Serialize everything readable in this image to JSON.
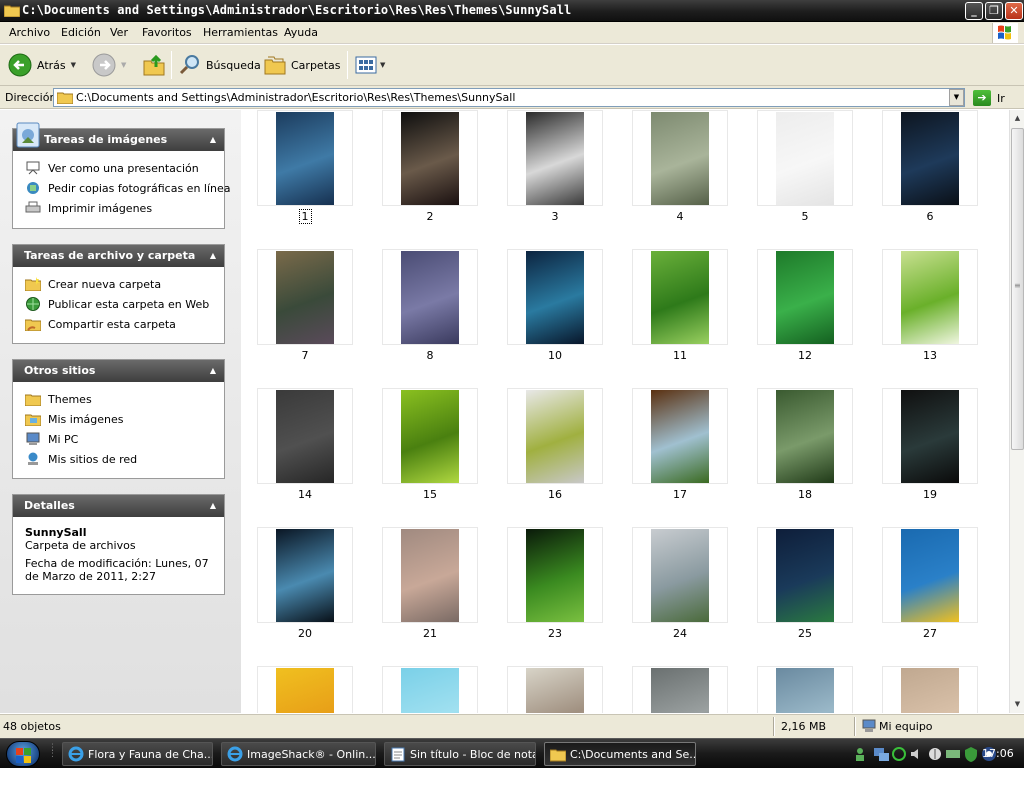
{
  "window": {
    "title": "C:\\Documents and Settings\\Administrador\\Escritorio\\Res\\Res\\Themes\\SunnySall"
  },
  "menu": [
    "Archivo",
    "Edición",
    "Ver",
    "Favoritos",
    "Herramientas",
    "Ayuda"
  ],
  "toolbar": {
    "back": "Atrás",
    "search": "Búsqueda",
    "folders": "Carpetas"
  },
  "address": {
    "label": "Dirección",
    "value": "C:\\Documents and Settings\\Administrador\\Escritorio\\Res\\Res\\Themes\\SunnySall",
    "go": "Ir"
  },
  "panels": {
    "images": {
      "title": "Tareas de imágenes",
      "items": [
        "Ver como una presentación",
        "Pedir copias fotográficas en línea",
        "Imprimir imágenes"
      ]
    },
    "files": {
      "title": "Tareas de archivo y carpeta",
      "items": [
        "Crear nueva carpeta",
        "Publicar esta carpeta en Web",
        "Compartir esta carpeta"
      ]
    },
    "places": {
      "title": "Otros sitios",
      "items": [
        "Themes",
        "Mis imágenes",
        "Mi PC",
        "Mis sitios de red"
      ]
    },
    "details": {
      "title": "Detalles",
      "name": "SunnySall",
      "type": "Carpeta de archivos",
      "modified": "Fecha de modificación: Lunes, 07 de Marzo de 2011, 2:27"
    }
  },
  "files": [
    {
      "label": "1",
      "colors": [
        "#1c3c5e",
        "#3f7aa6",
        "#163050"
      ]
    },
    {
      "label": "2",
      "colors": [
        "#0e0e0e",
        "#6a5a4a",
        "#1a1010"
      ]
    },
    {
      "label": "3",
      "colors": [
        "#2a2a2a",
        "#d8d8d8",
        "#3a3a3a"
      ]
    },
    {
      "label": "4",
      "colors": [
        "#7d8a70",
        "#a9b49a",
        "#556048"
      ]
    },
    {
      "label": "5",
      "colors": [
        "#ededed",
        "#f7f7f7",
        "#e4e4e4"
      ]
    },
    {
      "label": "6",
      "colors": [
        "#0d1520",
        "#1e3a5a",
        "#0a0f16"
      ]
    },
    {
      "label": "7",
      "colors": [
        "#7a6a4a",
        "#3a4a3a",
        "#5a4a5a"
      ]
    },
    {
      "label": "8",
      "colors": [
        "#4a4c74",
        "#7a7aa6",
        "#3a3a5e"
      ]
    },
    {
      "label": "10",
      "colors": [
        "#0c2440",
        "#2a7aa0",
        "#08162a"
      ]
    },
    {
      "label": "11",
      "colors": [
        "#6ab03a",
        "#2e7a1a",
        "#9ad060"
      ]
    },
    {
      "label": "12",
      "colors": [
        "#1e7a2a",
        "#3ab04a",
        "#146020"
      ]
    },
    {
      "label": "13",
      "colors": [
        "#c8e090",
        "#6ab02a",
        "#f0f6e0"
      ]
    },
    {
      "label": "14",
      "colors": [
        "#3a3a3a",
        "#505050",
        "#262626"
      ]
    },
    {
      "label": "15",
      "colors": [
        "#8ac020",
        "#4a8010",
        "#b0d840"
      ]
    },
    {
      "label": "16",
      "colors": [
        "#e8e8e8",
        "#a0b040",
        "#c8c8c8"
      ]
    },
    {
      "label": "17",
      "colors": [
        "#5a3010",
        "#a0c0d0",
        "#3a6a20"
      ]
    },
    {
      "label": "18",
      "colors": [
        "#3a5a30",
        "#7a9a6a",
        "#203a18"
      ]
    },
    {
      "label": "19",
      "colors": [
        "#101010",
        "#2a3a3a",
        "#0a0a0a"
      ]
    },
    {
      "label": "20",
      "colors": [
        "#0a1624",
        "#4a8ab0",
        "#081018"
      ]
    },
    {
      "label": "21",
      "colors": [
        "#a08a80",
        "#c8a898",
        "#7a6a64"
      ]
    },
    {
      "label": "23",
      "colors": [
        "#0a1a0a",
        "#3a8a20",
        "#7ac040"
      ]
    },
    {
      "label": "24",
      "colors": [
        "#c8ccd0",
        "#8a9aa0",
        "#4a6a3a"
      ]
    },
    {
      "label": "25",
      "colors": [
        "#0e1e3a",
        "#1a3a5a",
        "#2a7a40"
      ]
    },
    {
      "label": "27",
      "colors": [
        "#1a6ab0",
        "#2a80c8",
        "#f0c020"
      ]
    },
    {
      "label": "",
      "colors": [
        "#f0c020",
        "#e8a018",
        "#c86010"
      ]
    },
    {
      "label": "",
      "colors": [
        "#7ad0e8",
        "#a0e0f0",
        "#60c0d8"
      ]
    },
    {
      "label": "",
      "colors": [
        "#d8d4c8",
        "#a09080",
        "#e8e4d8"
      ]
    },
    {
      "label": "",
      "colors": [
        "#6a7070",
        "#9aa0a0",
        "#4a5050"
      ]
    },
    {
      "label": "",
      "colors": [
        "#6a8aa0",
        "#9ab8c8",
        "#4a6a80"
      ]
    },
    {
      "label": "",
      "colors": [
        "#c0a890",
        "#d8c0a8",
        "#a89078"
      ]
    }
  ],
  "status": {
    "count": "48 objetos",
    "size": "2,16 MB",
    "location": "Mi equipo"
  },
  "taskbar": {
    "tasks": [
      "Flora y Fauna de Cha...",
      "ImageShack® - Onlin...",
      "Sin título - Bloc de notas",
      "C:\\Documents and Se..."
    ],
    "clock": "17:06"
  }
}
